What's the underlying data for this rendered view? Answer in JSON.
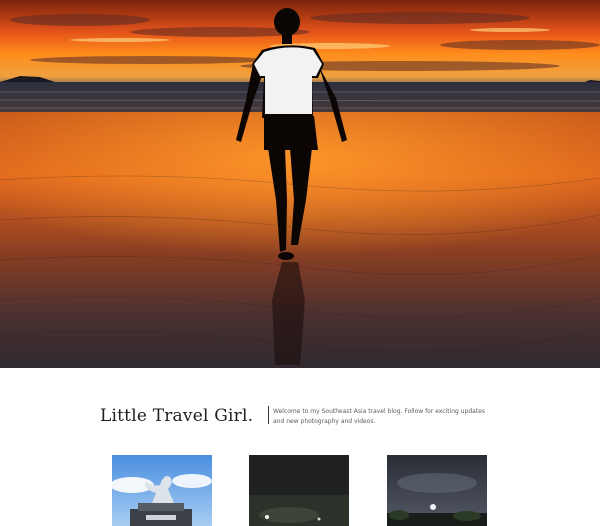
{
  "hero": {
    "image": "sunset-beach-silhouette-photo",
    "colors": {
      "sky_top": "#8a2a0e",
      "sky_glow": "#ff8a1a",
      "sand": "#5a3422",
      "silhouette": "#0b0604"
    }
  },
  "intro": {
    "site_title": "Little Travel Girl.",
    "tagline": "Welcome to my Southeast Asia travel blog. Follow for exciting updates and new photography and videos."
  },
  "gallery": {
    "thumbnails": [
      {
        "image": "dragon-statue-photo"
      },
      {
        "image": "night-scene-photo"
      },
      {
        "image": "night-sea-photo"
      }
    ]
  }
}
